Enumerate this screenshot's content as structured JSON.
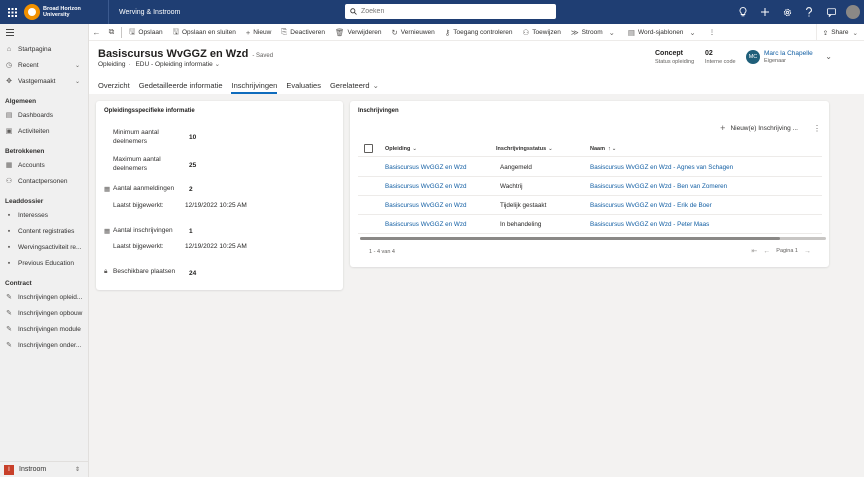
{
  "topbar": {
    "org_line1": "Broad Horizon",
    "org_line2": "University",
    "app_name": "Werving & Instroom",
    "search_placeholder": "Zoeken"
  },
  "sidebar": {
    "items_top": [
      {
        "label": "Startpagina",
        "icon": "home-icon"
      },
      {
        "label": "Recent",
        "icon": "clock-icon",
        "chevron": true
      },
      {
        "label": "Vastgemaakt",
        "icon": "pin-icon",
        "chevron": true
      }
    ],
    "groups": [
      {
        "title": "Algemeen",
        "items": [
          {
            "label": "Dashboards",
            "icon": "dashboard-icon"
          },
          {
            "label": "Activiteiten",
            "icon": "activity-icon"
          }
        ]
      },
      {
        "title": "Betrokkenen",
        "items": [
          {
            "label": "Accounts",
            "icon": "account-icon"
          },
          {
            "label": "Contactpersonen",
            "icon": "contact-icon"
          }
        ]
      },
      {
        "title": "Leaddossier",
        "items": [
          {
            "label": "Interesses",
            "icon": "entity-icon"
          },
          {
            "label": "Content registraties",
            "icon": "entity-icon"
          },
          {
            "label": "Wervingsactiviteit re...",
            "icon": "entity-icon"
          },
          {
            "label": "Previous Education",
            "icon": "entity-icon"
          }
        ]
      },
      {
        "title": "Contract",
        "items": [
          {
            "label": "Inschrijvingen opleid...",
            "icon": "edit-icon"
          },
          {
            "label": "Inschrijvingen opbouw",
            "icon": "edit-icon"
          },
          {
            "label": "Inschrijvingen module",
            "icon": "edit-icon"
          },
          {
            "label": "Inschrijvingen onder...",
            "icon": "edit-icon"
          }
        ]
      }
    ],
    "area": {
      "badge": "I",
      "label": "Instroom"
    }
  },
  "commandbar": {
    "buttons": [
      {
        "label": "Opslaan",
        "icon": "save-icon"
      },
      {
        "label": "Opslaan en sluiten",
        "icon": "save-close-icon"
      },
      {
        "label": "Nieuw",
        "icon": "plus-icon"
      },
      {
        "label": "Deactiveren",
        "icon": "deactivate-icon"
      },
      {
        "label": "Verwijderen",
        "icon": "delete-icon"
      },
      {
        "label": "Vernieuwen",
        "icon": "refresh-icon"
      },
      {
        "label": "Toegang controleren",
        "icon": "check-access-icon"
      },
      {
        "label": "Toewijzen",
        "icon": "assign-icon"
      },
      {
        "label": "Stroom",
        "icon": "flow-icon",
        "chevron": true
      },
      {
        "label": "Word-sjablonen",
        "icon": "word-icon",
        "chevron": true
      }
    ],
    "share": "Share"
  },
  "record": {
    "title": "Basiscursus WvGGZ en Wzd",
    "saved": "- Saved",
    "entity": "Opleiding",
    "form": "EDU - Opleiding informatie",
    "status_value": "Concept",
    "status_label": "Status opleiding",
    "code_value": "02",
    "code_label": "Interne code",
    "owner_initials": "MC",
    "owner_name": "Marc la Chapelle",
    "owner_label": "Eigenaar"
  },
  "tabs": [
    "Overzicht",
    "Gedetailleerde informatie",
    "Inschrijvingen",
    "Evaluaties",
    "Gerelateerd"
  ],
  "active_tab": "Inschrijvingen",
  "info_card": {
    "title": "Opleidingsspecifieke informatie",
    "min_label": "Minimum aantal deelnemers",
    "min_value": "10",
    "max_label": "Maximum aantal deelnemers",
    "max_value": "25",
    "aanmeldingen_label": "Aantal aanmeldingen",
    "aanmeldingen_value": "2",
    "updated1_label": "Laatst bijgewerkt:",
    "updated1_value": "12/19/2022 10:25 AM",
    "inschrijvingen_label": "Aantal inschrijvingen",
    "inschrijvingen_value": "1",
    "updated2_label": "Laatst bijgewerkt:",
    "updated2_value": "12/19/2022 10:25 AM",
    "plaatsen_label": "Beschikbare plaatsen",
    "plaatsen_value": "24"
  },
  "grid": {
    "title": "Inschrijvingen",
    "new_button": "Nieuw(e) Inschrijving ...",
    "columns": [
      "Opleiding",
      "Inschrijvingsstatus",
      "Naam"
    ],
    "rows": [
      {
        "opleiding": "Basiscursus WvGGZ en Wzd",
        "status": "Aangemeld",
        "naam": "Basiscursus WvGGZ en Wzd - Agnes van Schagen"
      },
      {
        "opleiding": "Basiscursus WvGGZ en Wzd",
        "status": "Wachtrij",
        "naam": "Basiscursus WvGGZ en Wzd - Ben van Zomeren"
      },
      {
        "opleiding": "Basiscursus WvGGZ en Wzd",
        "status": "Tijdelijk gestaakt",
        "naam": "Basiscursus WvGGZ en Wzd - Erik de Boer"
      },
      {
        "opleiding": "Basiscursus WvGGZ en Wzd",
        "status": "In behandeling",
        "naam": "Basiscursus WvGGZ en Wzd - Peter Maas"
      }
    ],
    "count_text": "1 - 4 van 4",
    "page_text": "Pagina 1"
  },
  "colors": {
    "topbar": "#1f3e73",
    "link": "#115ea3",
    "accent": "#0f6cbd",
    "logo": "#f29100"
  }
}
